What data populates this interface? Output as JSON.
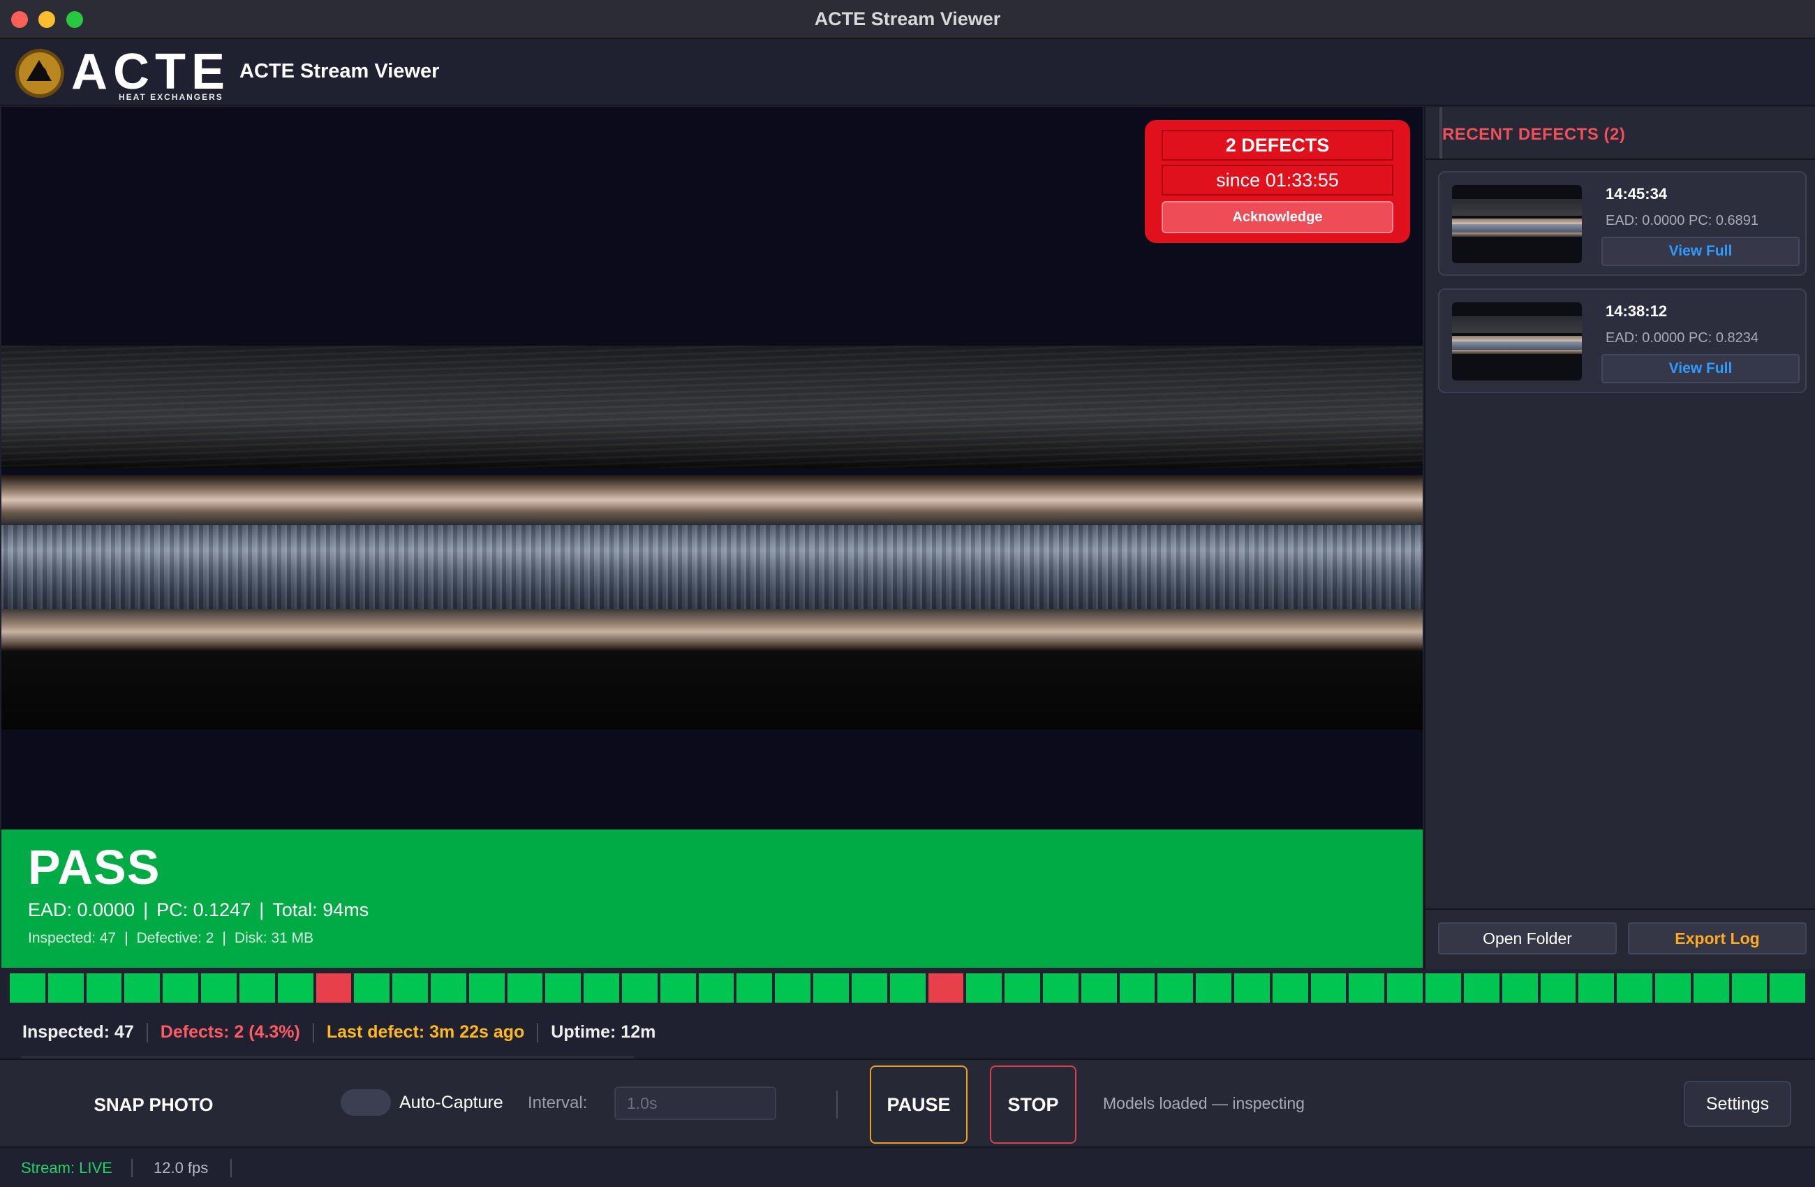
{
  "window": {
    "title": "ACTE Stream Viewer"
  },
  "header": {
    "logo_text": "ACTE",
    "logo_subtext": "HEAT EXCHANGERS",
    "app_title": "ACTE Stream Viewer"
  },
  "alert": {
    "count": "2 DEFECTS",
    "since": "since 01:33:55",
    "acknowledge_label": "Acknowledge",
    "color": "#e0101d"
  },
  "status": {
    "result": "PASS",
    "color": "#00aa44",
    "ead": "EAD: 0.0000",
    "pc": "PC: 0.1247",
    "total": "Total: 94ms",
    "inspected": "Inspected: 47",
    "defective": "Defective: 2",
    "disk": "Disk: 31 MB"
  },
  "timeline": {
    "cells": [
      "pass",
      "pass",
      "pass",
      "pass",
      "pass",
      "pass",
      "pass",
      "pass",
      "defect",
      "pass",
      "pass",
      "pass",
      "pass",
      "pass",
      "pass",
      "pass",
      "pass",
      "pass",
      "pass",
      "pass",
      "pass",
      "pass",
      "pass",
      "pass",
      "defect",
      "pass",
      "pass",
      "pass",
      "pass",
      "pass",
      "pass",
      "pass",
      "pass",
      "pass",
      "pass",
      "pass",
      "pass",
      "pass",
      "pass",
      "pass",
      "pass",
      "pass",
      "pass",
      "pass",
      "pass",
      "pass",
      "pass"
    ],
    "pass_color": "#00c551",
    "defect_color": "#e8404a"
  },
  "summary": {
    "inspected": "Inspected: 47",
    "defects": "Defects: 2 (4.3%)",
    "last_defect": "Last defect: 3m 22s ago",
    "uptime": "Uptime: 12m"
  },
  "controls": {
    "snap_label": "SNAP PHOTO",
    "auto_capture_label": "Auto-Capture",
    "auto_capture_on": false,
    "interval_label": "Interval:",
    "interval_placeholder": "1.0s",
    "pause_label": "PAUSE",
    "stop_label": "STOP",
    "models_status": "Models loaded — inspecting",
    "settings_label": "Settings"
  },
  "statusbar": {
    "stream": "Stream: LIVE",
    "fps": "12.0 fps"
  },
  "sidebar": {
    "title": "RECENT DEFECTS (2)",
    "defects": [
      {
        "time": "14:45:34",
        "scores": "EAD: 0.0000  PC: 0.6891",
        "view_label": "View Full"
      },
      {
        "time": "14:38:12",
        "scores": "EAD: 0.0000  PC: 0.8234",
        "view_label": "View Full"
      }
    ],
    "open_folder_label": "Open Folder",
    "export_log_label": "Export Log"
  }
}
